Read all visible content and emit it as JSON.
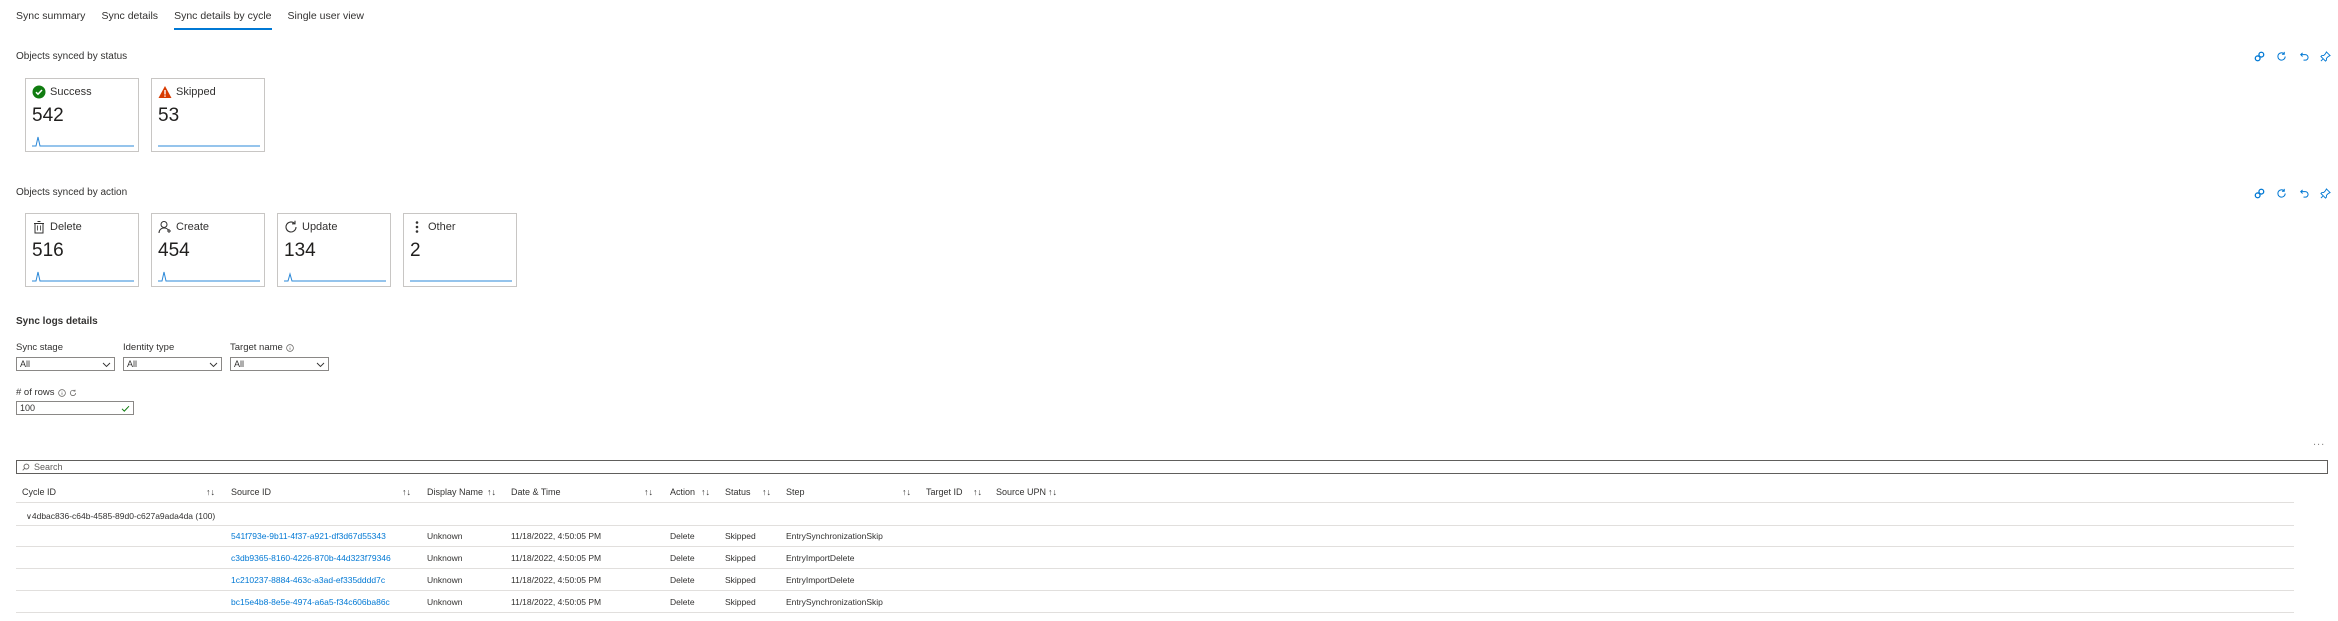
{
  "tabs": [
    "Sync summary",
    "Sync details",
    "Sync details by cycle",
    "Single user view"
  ],
  "active_tab": 2,
  "status_section": {
    "title": "Objects synced by status",
    "tiles": [
      {
        "label": "Success",
        "value": "542",
        "icon": "success-check-icon",
        "color": "#107c10"
      },
      {
        "label": "Skipped",
        "value": "53",
        "icon": "warning-icon",
        "color": "#d83b01"
      }
    ]
  },
  "action_section": {
    "title": "Objects synced by action",
    "tiles": [
      {
        "label": "Delete",
        "value": "516",
        "icon": "trash-icon"
      },
      {
        "label": "Create",
        "value": "454",
        "icon": "add-user-icon"
      },
      {
        "label": "Update",
        "value": "134",
        "icon": "refresh-icon"
      },
      {
        "label": "Other",
        "value": "2",
        "icon": "more-vertical-icon"
      }
    ]
  },
  "logs": {
    "title": "Sync logs details",
    "filters": [
      {
        "label": "Sync stage",
        "value": "All"
      },
      {
        "label": "Identity type",
        "value": "All"
      },
      {
        "label": "Target name",
        "value": "All",
        "info": true
      }
    ],
    "rows_filter": {
      "label": "# of rows",
      "value": "100"
    },
    "search_placeholder": "Search",
    "more": "...",
    "columns": [
      "Cycle ID",
      "Source ID",
      "Display Name",
      "Date & Time",
      "Action",
      "Status",
      "Step",
      "Target ID",
      "Source UPN"
    ],
    "group": "4dbac836-c64b-4585-89d0-c627a9ada4da (100)",
    "rows": [
      {
        "source_id": "541f793e-9b11-4f37-a921-df3d67d55343",
        "display_name": "Unknown",
        "date": "11/18/2022, 4:50:05 PM",
        "action": "Delete",
        "status": "Skipped",
        "step": "EntrySynchronizationSkip"
      },
      {
        "source_id": "c3db9365-8160-4226-870b-44d323f79346",
        "display_name": "Unknown",
        "date": "11/18/2022, 4:50:05 PM",
        "action": "Delete",
        "status": "Skipped",
        "step": "EntryImportDelete"
      },
      {
        "source_id": "1c210237-8884-463c-a3ad-ef335dddd7c",
        "display_name": "Unknown",
        "date": "11/18/2022, 4:50:05 PM",
        "action": "Delete",
        "status": "Skipped",
        "step": "EntryImportDelete"
      },
      {
        "source_id": "bc15e4b8-8e5e-4974-a6a5-f34c606ba86c",
        "display_name": "Unknown",
        "date": "11/18/2022, 4:50:05 PM",
        "action": "Delete",
        "status": "Skipped",
        "step": "EntrySynchronizationSkip"
      }
    ]
  },
  "colors": {
    "accent": "#0078d4",
    "success": "#107c10",
    "warning": "#d83b01",
    "spark": "#2b88d8"
  }
}
